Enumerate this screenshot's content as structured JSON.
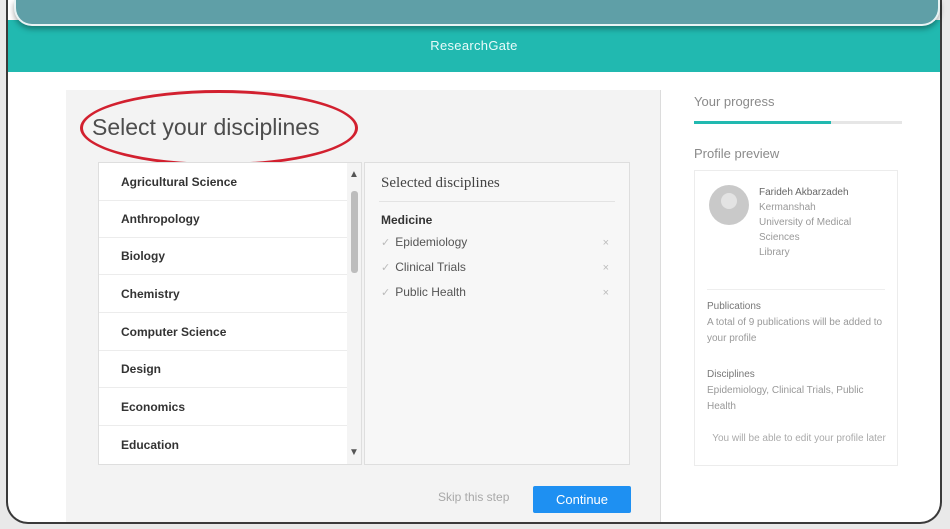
{
  "app": {
    "brand": "ResearchGate"
  },
  "onboarding": {
    "title": "Select your disciplines",
    "disciplines": [
      "Agricultural Science",
      "Anthropology",
      "Biology",
      "Chemistry",
      "Computer Science",
      "Design",
      "Economics",
      "Education"
    ],
    "selected": {
      "title": "Selected disciplines",
      "group": "Medicine",
      "items": [
        "Epidemiology",
        "Clinical Trials",
        "Public Health"
      ]
    },
    "skip_label": "Skip this step",
    "continue_label": "Continue"
  },
  "sidebar": {
    "progress_label": "Your progress",
    "progress_value": 0.66,
    "preview_label": "Profile preview",
    "profile": {
      "name": "Farideh Akbarzadeh",
      "line1": "Kermanshah",
      "line2": "University of Medical",
      "line3": "Sciences",
      "line4": "Library"
    },
    "publications_head": "Publications",
    "publications_text": "A total of 9 publications will be added to your profile",
    "disciplines_head": "Disciplines",
    "disciplines_text": "Epidemiology, Clinical Trials, Public Health",
    "note": "You will be able to edit your profile later"
  },
  "colors": {
    "teal": "#21b9b0",
    "accent_blue": "#1e90f2",
    "annotation_red": "#d2202f"
  },
  "icons": {
    "scroll_up": "▲",
    "scroll_down": "▼",
    "check": "✓",
    "remove": "×"
  }
}
